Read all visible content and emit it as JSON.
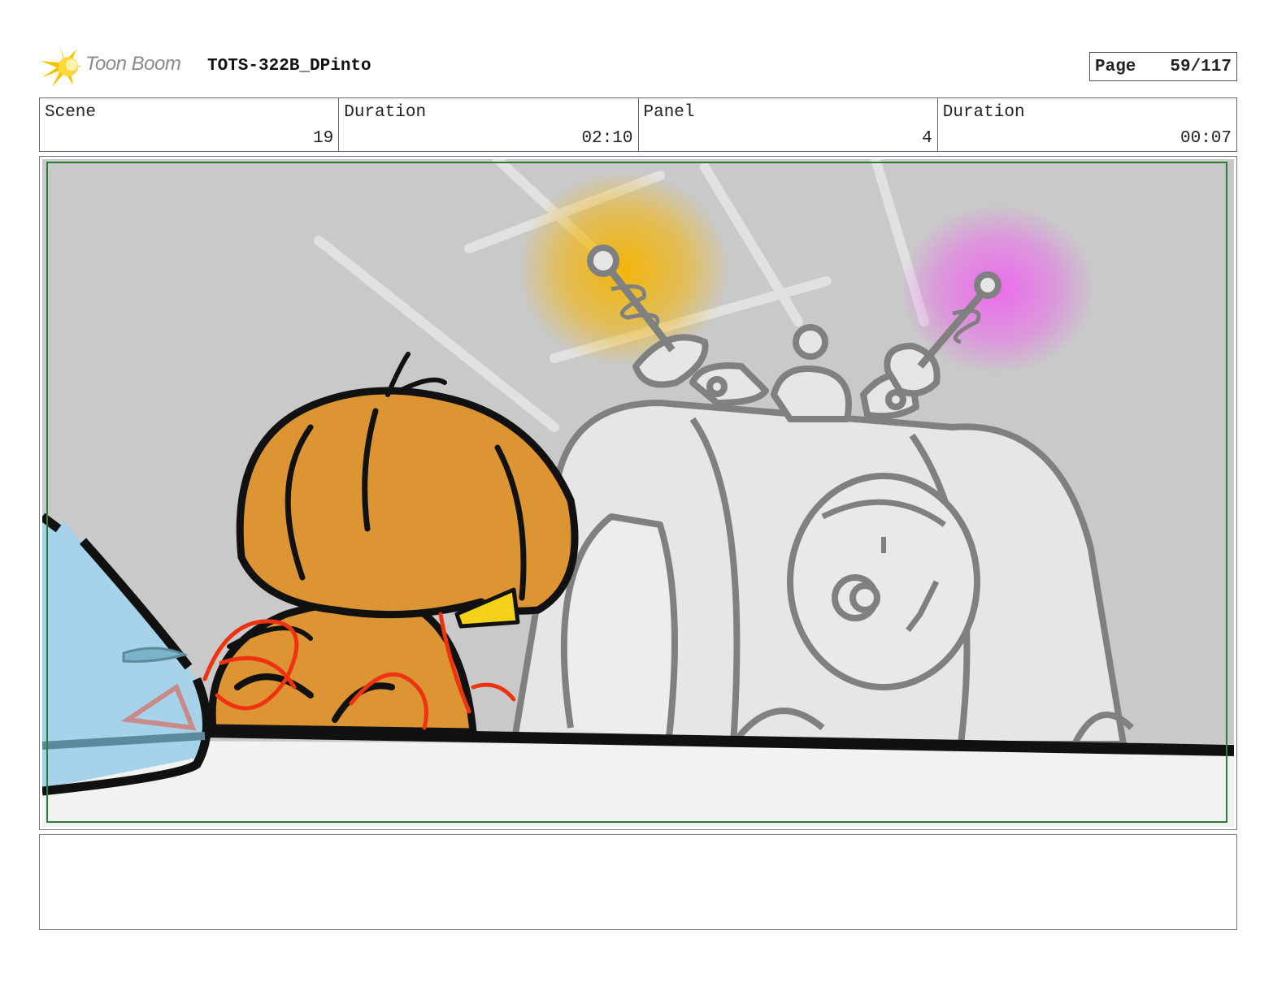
{
  "header": {
    "logo_text": "Toon Boom",
    "title": "TOTS-322B_DPinto",
    "page_label": "Page",
    "page_value": "59/117"
  },
  "info": {
    "scene_label": "Scene",
    "scene_value": "19",
    "scene_duration_label": "Duration",
    "scene_duration_value": "02:10",
    "panel_label": "Panel",
    "panel_value": "4",
    "panel_duration_label": "Duration",
    "panel_duration_value": "00:07"
  },
  "colors": {
    "logo_burst": "#f5c400",
    "safe_frame": "#2e7d32",
    "wall": "#c9c9c9",
    "counter": "#f2f2f2",
    "character": "#dc9532",
    "machine": "#e6e6e6",
    "glow_yellow": "#f5b400",
    "glow_pink": "#ee66ee",
    "glass": "#a6d3ea"
  },
  "notes": {
    "text": ""
  }
}
